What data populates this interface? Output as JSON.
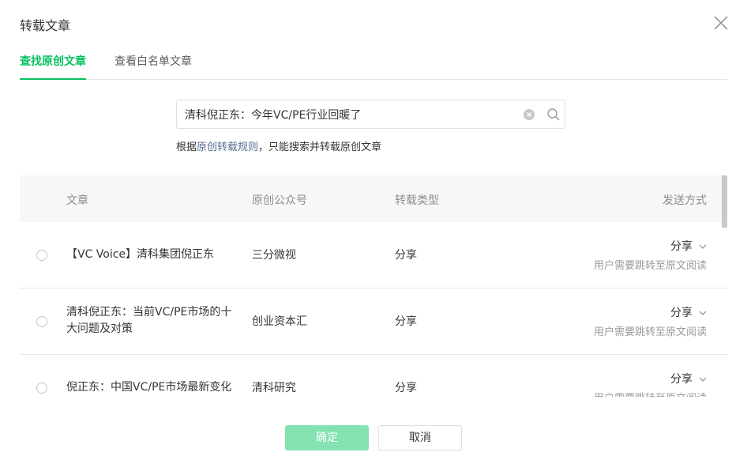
{
  "dialog": {
    "title": "转载文章",
    "close_icon": "close-icon"
  },
  "tabs": [
    {
      "label": "查找原创文章",
      "active": true
    },
    {
      "label": "查看白名单文章",
      "active": false
    }
  ],
  "search": {
    "value": "清科倪正东：今年VC/PE行业回暖了",
    "placeholder": "",
    "clear_icon": "clear-icon",
    "search_icon": "search-icon"
  },
  "hint": {
    "prefix": "根据",
    "link": "原创转载规则",
    "suffix": "，只能搜索并转载原创文章"
  },
  "table": {
    "headers": {
      "article": "文章",
      "account": "原创公众号",
      "type": "转载类型",
      "send": "发送方式"
    },
    "rows": [
      {
        "article": "【VC Voice】清科集团倪正东",
        "account": "三分微视",
        "type": "分享",
        "send": "分享",
        "note": "用户需要跳转至原文阅读"
      },
      {
        "article": "清科倪正东：当前VC/PE市场的十大问题及对策",
        "account": "创业资本汇",
        "type": "分享",
        "send": "分享",
        "note": "用户需要跳转至原文阅读"
      },
      {
        "article": "倪正东：中国VC/PE市场最新变化",
        "account": "清科研究",
        "type": "分享",
        "send": "分享",
        "note": "用户需要跳转至原文阅读"
      }
    ]
  },
  "footer": {
    "confirm_label": "确定",
    "cancel_label": "取消"
  },
  "colors": {
    "accent": "#07c160",
    "confirm_disabled": "#84e2b0",
    "link": "#576b95"
  }
}
